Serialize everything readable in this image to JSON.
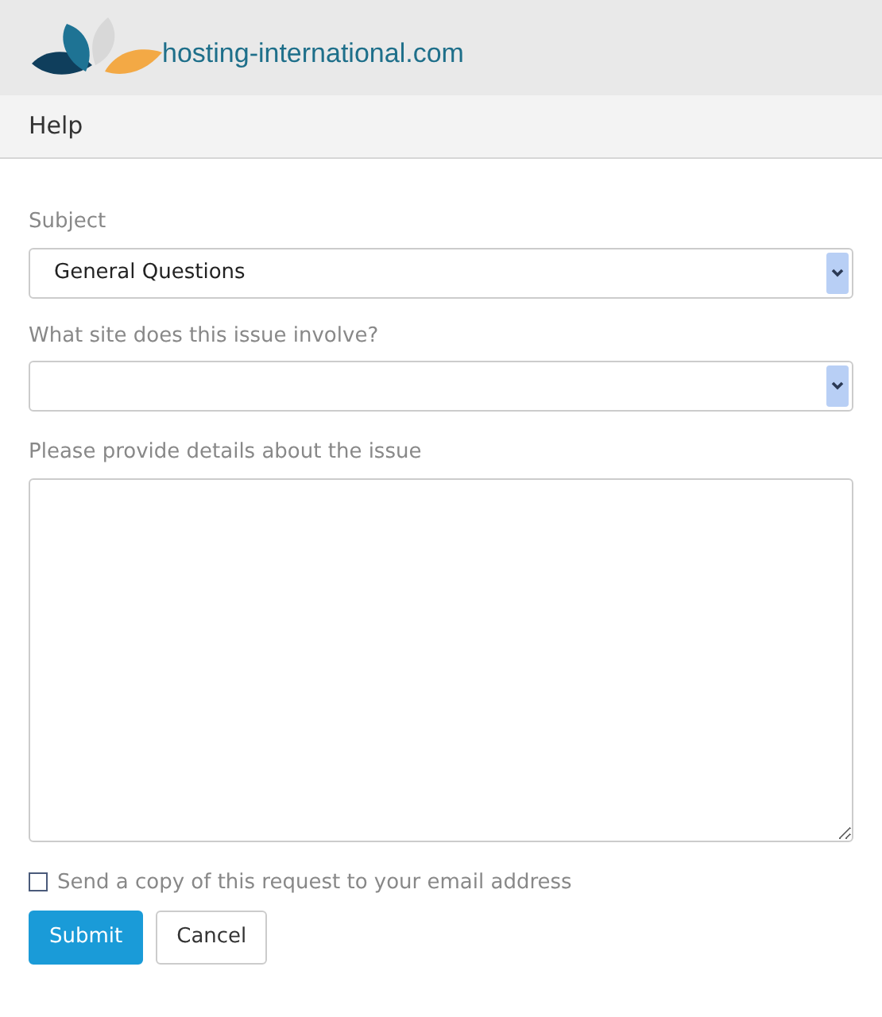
{
  "header": {
    "logo_text": "hosting-international.com"
  },
  "title": "Help",
  "form": {
    "subject": {
      "label": "Subject",
      "value": "General Questions"
    },
    "site": {
      "label": "What site does this issue involve?"
    },
    "details": {
      "label": "Please provide details about the issue"
    },
    "copy": {
      "label": "Send a copy of this request to your email address",
      "checked": false
    },
    "buttons": [
      {
        "label": "Submit",
        "kind": "primary"
      },
      {
        "label": "Cancel",
        "kind": "secondary"
      }
    ]
  }
}
